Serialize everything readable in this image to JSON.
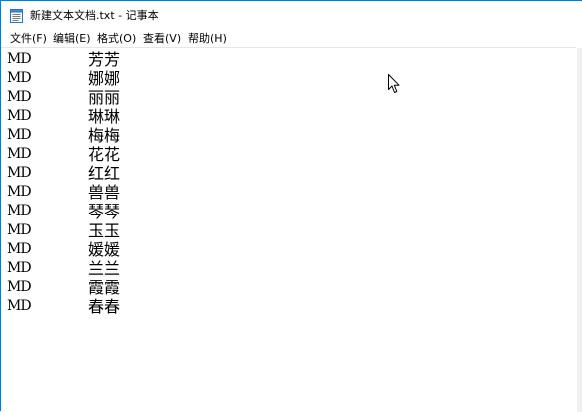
{
  "window": {
    "title": "新建文本文档.txt - 记事本",
    "icon": "notepad-icon"
  },
  "menu": [
    {
      "label": "文件(F)"
    },
    {
      "label": "编辑(E)"
    },
    {
      "label": "格式(O)"
    },
    {
      "label": "查看(V)"
    },
    {
      "label": "帮助(H)"
    }
  ],
  "document": {
    "lines": [
      {
        "code": "MD",
        "name": "芳芳"
      },
      {
        "code": "MD",
        "name": "娜娜"
      },
      {
        "code": "MD",
        "name": "丽丽"
      },
      {
        "code": "MD",
        "name": "琳琳"
      },
      {
        "code": "MD",
        "name": "梅梅"
      },
      {
        "code": "MD",
        "name": "花花"
      },
      {
        "code": "MD",
        "name": "红红"
      },
      {
        "code": "MD",
        "name": "兽兽"
      },
      {
        "code": "MD",
        "name": "琴琴"
      },
      {
        "code": "MD",
        "name": "玉玉"
      },
      {
        "code": "MD",
        "name": "媛媛"
      },
      {
        "code": "MD",
        "name": "兰兰"
      },
      {
        "code": "MD",
        "name": "霞霞"
      },
      {
        "code": "MD",
        "name": "春春"
      }
    ]
  },
  "pointer": {
    "icon": "mouse-pointer-icon"
  }
}
